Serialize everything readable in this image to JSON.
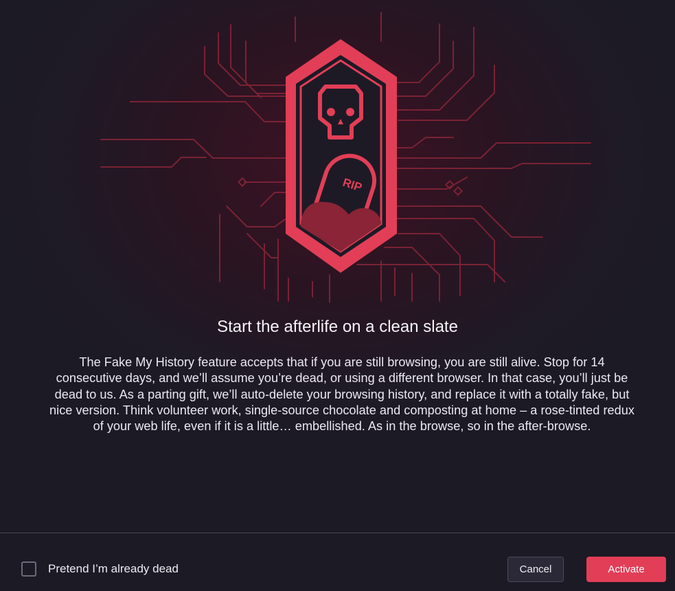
{
  "dialog": {
    "headline": "Start the afterlife on a clean slate",
    "body": "The Fake My History feature accepts that if you are still browsing, you are still alive. Stop for 14 consecutive days, and we’ll assume you’re dead, or using a different browser. In that case, you’ll just be dead to us. As a parting gift, we’ll auto-delete your browsing history, and replace it with a totally fake, but nice version. Think volunteer work, single-source chocolate and composting at home – a rose-tinted redux of your web life, even if it is a little… embellished. As in the browse, so in the after-browse."
  },
  "illustration": {
    "tombstone_text": "RIP",
    "icons": [
      "skull-icon",
      "tombstone-icon"
    ]
  },
  "footer": {
    "checkbox_label": "Pretend I’m already dead",
    "checkbox_checked": false,
    "cancel_label": "Cancel",
    "activate_label": "Activate"
  },
  "colors": {
    "accent": "#e23e57",
    "background": "#1c1a25",
    "circuit": "#7a2234"
  }
}
